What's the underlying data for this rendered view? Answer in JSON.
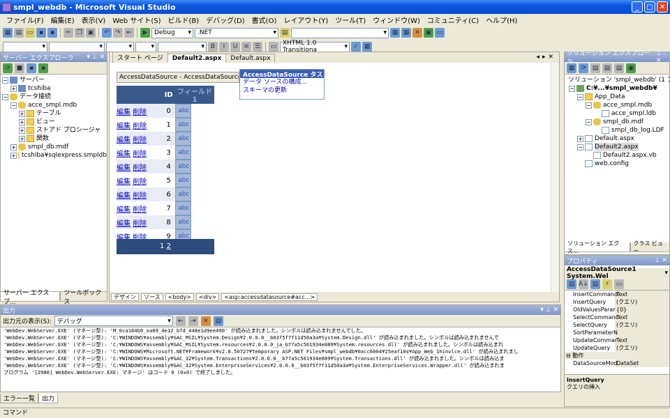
{
  "window": {
    "title": "smpl_webdb - Microsoft Visual Studio"
  },
  "menu": [
    "ファイル(F)",
    "編集(E)",
    "表示(V)",
    "Web サイト(S)",
    "ビルド(B)",
    "デバッグ(D)",
    "書式(O)",
    "レイアウト(Y)",
    "ツール(T)",
    "ウィンドウ(W)",
    "コミュニティ(C)",
    "ヘルプ(H)"
  ],
  "toolbar": {
    "config": "Debug",
    "platform": ".NET",
    "doctype": "XHTML 1.0 Transitiona"
  },
  "server_explorer": {
    "title": "サーバー エクスプローラ",
    "nodes": [
      "サーバー",
      "tcshiba",
      "データ接続",
      "acce_smpl.mdb",
      "テーブル",
      "ビュー",
      "ストアド プロシージャ",
      "関数",
      "smpl_db.mdf",
      "tcshiba¥sqlexpress.smpldb"
    ],
    "tabs": [
      "サーバー エクスプ...",
      "ツールボックス"
    ]
  },
  "editor": {
    "tabs": [
      "スタート ページ",
      "Default2.aspx",
      "Default.aspx"
    ],
    "datasource_label": "AccessDataSource - AccessDataSource1",
    "smart_tag": {
      "title": "AccessDataSource タスク",
      "items": [
        "データ ソースの構成...",
        "スキーマの更新"
      ]
    },
    "grid": {
      "headers": [
        "ID",
        "フィールド1"
      ],
      "edit": "編集",
      "delete": "削除",
      "rows": [
        {
          "id": "0",
          "field": "abc"
        },
        {
          "id": "1",
          "field": "abc"
        },
        {
          "id": "2",
          "field": "abc"
        },
        {
          "id": "3",
          "field": "abc"
        },
        {
          "id": "4",
          "field": "abc"
        },
        {
          "id": "5",
          "field": "abc"
        },
        {
          "id": "6",
          "field": "abc"
        },
        {
          "id": "7",
          "field": "abc"
        },
        {
          "id": "8",
          "field": "abc"
        },
        {
          "id": "9",
          "field": "abc"
        }
      ],
      "pager_1": "1",
      "pager_2": "2"
    },
    "bottom": {
      "design": "デザイン",
      "source": "ソース",
      "tags": [
        "<body>",
        "<div>",
        "<asp:accessdatasource#acc...>"
      ]
    }
  },
  "solution_explorer": {
    "title": "ソリューション エクスプローラ - ...",
    "nodes": [
      "ソリューション 'smpl_webdb' (1 プロジ",
      "C:¥...¥smpl_webdb¥",
      "App_Data",
      "acce_smpl.mdb",
      "acce_smpl.ldb",
      "smpl_db.mdf",
      "smpl_db_log.LDF",
      "Default.aspx",
      "Default2.aspx",
      "Default2.aspx.vb",
      "web.config"
    ],
    "tabs": [
      "ソリューション エクス...",
      "クラス ビュー"
    ]
  },
  "properties": {
    "title": "プロパティ",
    "object": "AccessDataSource1 System.Wel",
    "rows": [
      {
        "k": "InsertCommand",
        "v": "Text"
      },
      {
        "k": "InsertQuery",
        "v": "(クエリ)"
      },
      {
        "k": "OldValuesParar",
        "v": "{0}"
      },
      {
        "k": "SelectCommanc",
        "v": "Text"
      },
      {
        "k": "SelectQuery",
        "v": "(クエリ)"
      },
      {
        "k": "SortParameterN",
        "v": ""
      },
      {
        "k": "UpdateCommar",
        "v": "Text"
      },
      {
        "k": "UpdateQuery",
        "v": "(クエリ)"
      },
      {
        "k": "⊟ 動作",
        "v": ""
      },
      {
        "k": "DataSourceMod",
        "v": "DataSet"
      }
    ],
    "desc_title": "InsertQuery",
    "desc_text": "クエリの挿入"
  },
  "output": {
    "title": "出力",
    "source_label": "出力元の表示(S):",
    "source_value": "デバッグ",
    "lines": [
      "'WebDev.WebServer.EXE' (マネージ型): 'M_0ca184b0_xa09_4e12_b7d_448e1d9ee490' が読み込まれました。シンボルは読み込まれませんでした。",
      "'WebDev.WebServer.EXE' (マネージ型): 'C:¥WINDOWS¥assembly¥GAC_MSIL¥System.Design¥2.0.0.0__b03f5f7f11d50a3a¥System.Design.dll' が読み込まれました。シンボルは読み込まれませんで",
      "'WebDev.WebServer.EXE' (マネージ型): 'C:¥WINDOWS¥assembly¥GAC_MSIL¥System.resources¥2.0.0.0_ja_b77a5c561934e089¥System.resources.dll' が読み込まれました。シンボルは読み込まれ",
      "'WebDev.WebServer.EXE' (マネージ型): 'C:¥WINDOWS¥Microsoft.NET¥Framework¥v2.0.50727¥Temporary ASP.NET Files¥smpl_webdb¥0acc6004¥25eaf10¢¥App_Web_1hinvlce.dll' が読み込まれまし",
      "'WebDev.WebServer.EXE' (マネージ型): 'C:¥WINDOWS¥assembly¥GAC_32¥System.Transactions¥2.0.0.0__b77a5c561934e089¥System.Transactions.dll' が読み込まれました。シンボルは読み込ま",
      "'WebDev.WebServer.EXE' (マネージ型): 'C:¥WINDOWS¥assembly¥GAC_32¥System.EnterpriseServices¥2.0.0.0__b03f5f7f11d50a3a¥System.EnterpriseServices.Wrapper.dll' が読み込まれま",
      "プログラム '[2980] WebDev.WebServer.EXE: マネージ' はコード 0 (0x0) で終了しました。"
    ],
    "tabs": [
      "エラー一覧",
      "出力"
    ]
  },
  "status": "コマンド"
}
